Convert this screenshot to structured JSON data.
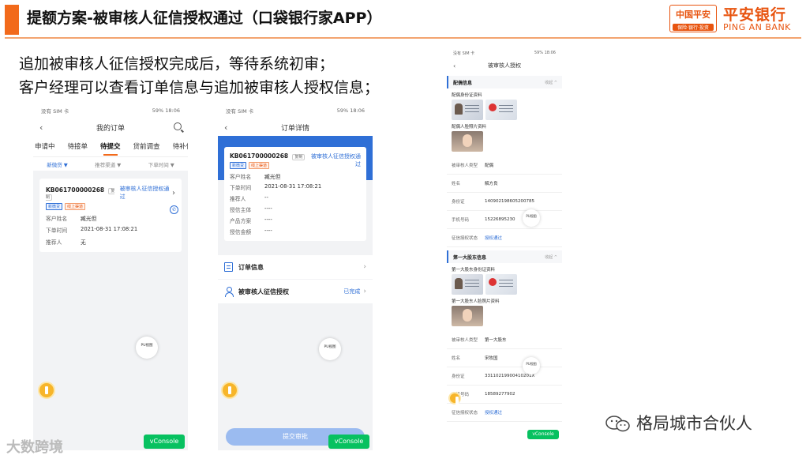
{
  "slide": {
    "title": "提额方案-被审核人征信授权通过（口袋银行家APP）",
    "line1": "追加被审核人征信授权完成后，等待系统初审；",
    "line2": "客户经理可以查看订单信息与追加被审核人授权信息；"
  },
  "logo": {
    "box_top": "中国平安",
    "box_bottom": "保险·银行·投资",
    "bank_cn": "平安银行",
    "bank_en": "PING AN BANK",
    "brand_color": "#e8540f"
  },
  "common": {
    "status_left": "没有 SIM 卡",
    "status_right": "59% 18:06",
    "pu_label": "PU视图",
    "vconsole": "vConsole",
    "copy": "复制",
    "tag_product": "新微贷",
    "tag_channel": "线上渠道",
    "order_id": "KB061700000268",
    "order_status": "被审核人征信授权通过",
    "chevron": "›",
    "back": "‹"
  },
  "phone1": {
    "title": "我的订单",
    "tabs": [
      "申请中",
      "待接单",
      "待提交",
      "贷前调查",
      "待补件"
    ],
    "active_tab": 2,
    "filters": [
      "新微贷 ▼",
      "推荐渠道 ▼",
      "下单时间 ▼"
    ],
    "fields": [
      {
        "k": "客户姓名",
        "v": "臧光但"
      },
      {
        "k": "下单时间",
        "v": "2021-08-31 17:08:21"
      },
      {
        "k": "推荐人",
        "v": "无"
      }
    ]
  },
  "phone2": {
    "title": "订单详情",
    "fields": [
      {
        "k": "客户姓名",
        "v": "臧光但"
      },
      {
        "k": "下单时间",
        "v": "2021-08-31 17:08:21"
      },
      {
        "k": "推荐人",
        "v": "--"
      },
      {
        "k": "授信主体",
        "v": "----"
      },
      {
        "k": "产品方案",
        "v": "----"
      },
      {
        "k": "授信金额",
        "v": "----"
      }
    ],
    "menu_order": "订单信息",
    "menu_auth": "被审核人征信授权",
    "menu_auth_status": "已完成",
    "submit": "提交审批"
  },
  "phone3": {
    "title": "被审核人授权",
    "collapse": "收起 ^",
    "spouse": {
      "header": "配偶信息",
      "id_label": "配偶身份证资料",
      "face_label": "配偶人脸照片资料",
      "fields": [
        {
          "k": "被审核人类型",
          "v": "配偶"
        },
        {
          "k": "姓名",
          "v": "解方良"
        },
        {
          "k": "身份证",
          "v": "140902198605200785"
        },
        {
          "k": "手机号码",
          "v": "15226895230"
        }
      ],
      "auth_k": "征信授权状态",
      "auth_v": "授权通过"
    },
    "shareholder": {
      "header": "第一大股东信息",
      "id_label": "第一大股东身份证资料",
      "face_label": "第一大股东人脸照片资料",
      "fields": [
        {
          "k": "被审核人类型",
          "v": "第一大股东"
        },
        {
          "k": "姓名",
          "v": "宋牧国"
        },
        {
          "k": "身份证",
          "v": "33110219900410201X"
        },
        {
          "k": "手机号码",
          "v": "18589277902"
        }
      ],
      "auth_k": "征信授权状态",
      "auth_v": "授权通过"
    }
  },
  "watermark": {
    "left": "大数跨境",
    "right": "格局城市合伙人"
  }
}
